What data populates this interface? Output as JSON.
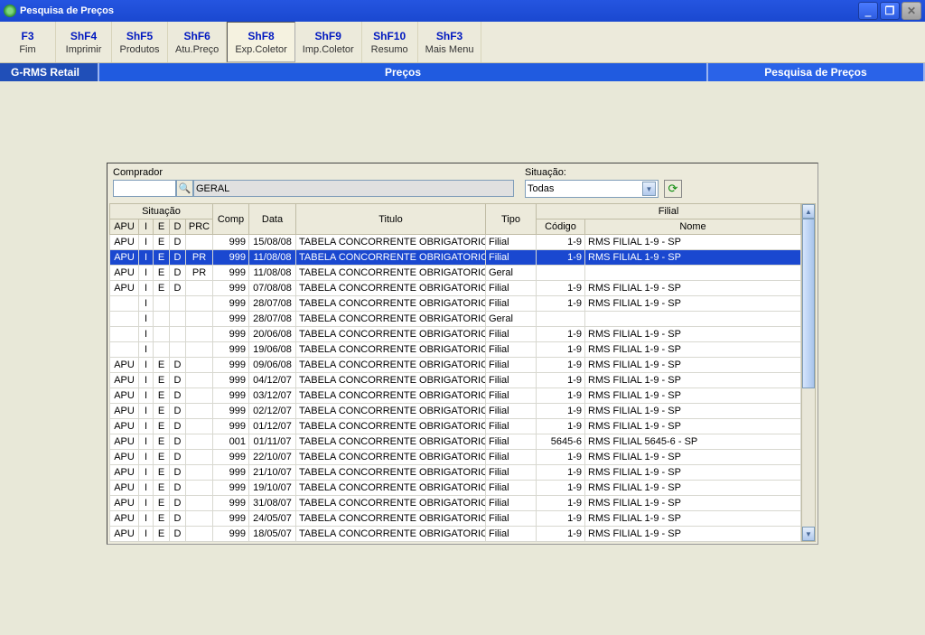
{
  "window": {
    "title": "Pesquisa de Preços"
  },
  "toolbar": [
    {
      "key": "F3",
      "label": "Fim"
    },
    {
      "key": "ShF4",
      "label": "Imprimir"
    },
    {
      "key": "ShF5",
      "label": "Produtos"
    },
    {
      "key": "ShF6",
      "label": "Atu.Preço"
    },
    {
      "key": "ShF8",
      "label": "Exp.Coletor",
      "active": true
    },
    {
      "key": "ShF9",
      "label": "Imp.Coletor"
    },
    {
      "key": "ShF10",
      "label": "Resumo"
    },
    {
      "key": "ShF3",
      "label": "Mais Menu"
    }
  ],
  "crumbs": {
    "first": "G-RMS Retail",
    "mid": "Preços",
    "last": "Pesquisa de Preços"
  },
  "form": {
    "compradorLabel": "Comprador",
    "compradorDesc": "GERAL",
    "situacaoLabel": "Situação:",
    "situacaoValue": "Todas"
  },
  "headers": {
    "situacao": "Situação",
    "apu": "APU",
    "i": "I",
    "e": "E",
    "d": "D",
    "prc": "PRC",
    "comp": "Comp",
    "data": "Data",
    "titulo": "Titulo",
    "tipo": "Tipo",
    "filial": "Filial",
    "codigo": "Código",
    "nome": "Nome"
  },
  "rows": [
    {
      "apu": "APU",
      "i": "I",
      "e": "E",
      "d": "D",
      "prc": "",
      "comp": "999",
      "data": "15/08/08",
      "titulo": "TABELA CONCORRENTE OBRIGATORIO",
      "tipo": "Filial",
      "codigo": "1-9",
      "nome": "RMS FILIAL 1-9 - SP"
    },
    {
      "apu": "APU",
      "i": "I",
      "e": "E",
      "d": "D",
      "prc": "PR",
      "comp": "999",
      "data": "11/08/08",
      "titulo": "TABELA CONCORRENTE OBRIGATORIO",
      "tipo": "Filial",
      "codigo": "1-9",
      "nome": "RMS FILIAL 1-9 - SP",
      "sel": true
    },
    {
      "apu": "APU",
      "i": "I",
      "e": "E",
      "d": "D",
      "prc": "PR",
      "comp": "999",
      "data": "11/08/08",
      "titulo": "TABELA CONCORRENTE OBRIGATORIO",
      "tipo": "Geral",
      "codigo": "",
      "nome": ""
    },
    {
      "apu": "APU",
      "i": "I",
      "e": "E",
      "d": "D",
      "prc": "",
      "comp": "999",
      "data": "07/08/08",
      "titulo": "TABELA CONCORRENTE OBRIGATORIO",
      "tipo": "Filial",
      "codigo": "1-9",
      "nome": "RMS FILIAL 1-9 - SP"
    },
    {
      "apu": "",
      "i": "I",
      "e": "",
      "d": "",
      "prc": "",
      "comp": "999",
      "data": "28/07/08",
      "titulo": "TABELA CONCORRENTE OBRIGATORIO",
      "tipo": "Filial",
      "codigo": "1-9",
      "nome": "RMS FILIAL 1-9 - SP"
    },
    {
      "apu": "",
      "i": "I",
      "e": "",
      "d": "",
      "prc": "",
      "comp": "999",
      "data": "28/07/08",
      "titulo": "TABELA CONCORRENTE OBRIGATORIO",
      "tipo": "Geral",
      "codigo": "",
      "nome": ""
    },
    {
      "apu": "",
      "i": "I",
      "e": "",
      "d": "",
      "prc": "",
      "comp": "999",
      "data": "20/06/08",
      "titulo": "TABELA CONCORRENTE OBRIGATORIO",
      "tipo": "Filial",
      "codigo": "1-9",
      "nome": "RMS FILIAL 1-9 - SP"
    },
    {
      "apu": "",
      "i": "I",
      "e": "",
      "d": "",
      "prc": "",
      "comp": "999",
      "data": "19/06/08",
      "titulo": "TABELA CONCORRENTE OBRIGATORIO",
      "tipo": "Filial",
      "codigo": "1-9",
      "nome": "RMS FILIAL 1-9 - SP"
    },
    {
      "apu": "APU",
      "i": "I",
      "e": "E",
      "d": "D",
      "prc": "",
      "comp": "999",
      "data": "09/06/08",
      "titulo": "TABELA CONCORRENTE OBRIGATORIO",
      "tipo": "Filial",
      "codigo": "1-9",
      "nome": "RMS FILIAL 1-9 - SP"
    },
    {
      "apu": "APU",
      "i": "I",
      "e": "E",
      "d": "D",
      "prc": "",
      "comp": "999",
      "data": "04/12/07",
      "titulo": "TABELA CONCORRENTE OBRIGATORIO",
      "tipo": "Filial",
      "codigo": "1-9",
      "nome": "RMS FILIAL 1-9 - SP"
    },
    {
      "apu": "APU",
      "i": "I",
      "e": "E",
      "d": "D",
      "prc": "",
      "comp": "999",
      "data": "03/12/07",
      "titulo": "TABELA CONCORRENTE OBRIGATORIO",
      "tipo": "Filial",
      "codigo": "1-9",
      "nome": "RMS FILIAL 1-9 - SP"
    },
    {
      "apu": "APU",
      "i": "I",
      "e": "E",
      "d": "D",
      "prc": "",
      "comp": "999",
      "data": "02/12/07",
      "titulo": "TABELA CONCORRENTE OBRIGATORIO",
      "tipo": "Filial",
      "codigo": "1-9",
      "nome": "RMS FILIAL 1-9 - SP"
    },
    {
      "apu": "APU",
      "i": "I",
      "e": "E",
      "d": "D",
      "prc": "",
      "comp": "999",
      "data": "01/12/07",
      "titulo": "TABELA CONCORRENTE OBRIGATORIO",
      "tipo": "Filial",
      "codigo": "1-9",
      "nome": "RMS FILIAL 1-9 - SP"
    },
    {
      "apu": "APU",
      "i": "I",
      "e": "E",
      "d": "D",
      "prc": "",
      "comp": "001",
      "data": "01/11/07",
      "titulo": "TABELA CONCORRENTE OBRIGATORIO",
      "tipo": "Filial",
      "codigo": "5645-6",
      "nome": "RMS FILIAL 5645-6 - SP"
    },
    {
      "apu": "APU",
      "i": "I",
      "e": "E",
      "d": "D",
      "prc": "",
      "comp": "999",
      "data": "22/10/07",
      "titulo": "TABELA CONCORRENTE OBRIGATORIO",
      "tipo": "Filial",
      "codigo": "1-9",
      "nome": "RMS FILIAL 1-9 - SP"
    },
    {
      "apu": "APU",
      "i": "I",
      "e": "E",
      "d": "D",
      "prc": "",
      "comp": "999",
      "data": "21/10/07",
      "titulo": "TABELA CONCORRENTE OBRIGATORIO",
      "tipo": "Filial",
      "codigo": "1-9",
      "nome": "RMS FILIAL 1-9 - SP"
    },
    {
      "apu": "APU",
      "i": "I",
      "e": "E",
      "d": "D",
      "prc": "",
      "comp": "999",
      "data": "19/10/07",
      "titulo": "TABELA CONCORRENTE OBRIGATORIO",
      "tipo": "Filial",
      "codigo": "1-9",
      "nome": "RMS FILIAL 1-9 - SP"
    },
    {
      "apu": "APU",
      "i": "I",
      "e": "E",
      "d": "D",
      "prc": "",
      "comp": "999",
      "data": "31/08/07",
      "titulo": "TABELA CONCORRENTE OBRIGATORIO",
      "tipo": "Filial",
      "codigo": "1-9",
      "nome": "RMS FILIAL 1-9 - SP"
    },
    {
      "apu": "APU",
      "i": "I",
      "e": "E",
      "d": "D",
      "prc": "",
      "comp": "999",
      "data": "24/05/07",
      "titulo": "TABELA CONCORRENTE OBRIGATORIO",
      "tipo": "Filial",
      "codigo": "1-9",
      "nome": "RMS FILIAL 1-9 - SP"
    },
    {
      "apu": "APU",
      "i": "I",
      "e": "E",
      "d": "D",
      "prc": "",
      "comp": "999",
      "data": "18/05/07",
      "titulo": "TABELA CONCORRENTE OBRIGATORIO",
      "tipo": "Filial",
      "codigo": "1-9",
      "nome": "RMS FILIAL 1-9 - SP"
    }
  ]
}
